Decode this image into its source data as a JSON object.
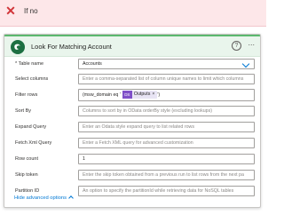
{
  "condition": {
    "title": "If no"
  },
  "card": {
    "title": "Look For Matching Account",
    "help_label": "?",
    "more_label": "···"
  },
  "fields": [
    {
      "label": "* Table name",
      "value": "Accounts",
      "placeholder": ""
    },
    {
      "label": "Select columns",
      "value": "",
      "placeholder": "Enter a comma-separated list of column unique names to limit which columns"
    },
    {
      "label": "Filter rows",
      "value": "(msw_domain eq '",
      "suffix": "')",
      "token": {
        "icon_label": "DS",
        "text": "Outputs",
        "remove": "×"
      }
    },
    {
      "label": "Sort By",
      "value": "",
      "placeholder": "Columns to sort by in OData orderBy style (excluding lookups)"
    },
    {
      "label": "Expand Query",
      "value": "",
      "placeholder": "Enter an Odata style expand query to list related rows"
    },
    {
      "label": "Fetch Xml Query",
      "value": "",
      "placeholder": "Enter a Fetch XML query for advanced customization"
    },
    {
      "label": "Row count",
      "value": "1",
      "placeholder": ""
    },
    {
      "label": "Skip token",
      "value": "",
      "placeholder": "Enter the skip token obtained from a previous run to list rows from the next pa"
    },
    {
      "label": "Partition ID",
      "value": "",
      "placeholder": "An option to specify the partitionId while retrieving data for NoSQL tables"
    }
  ],
  "advanced": {
    "label": "Hide advanced options"
  },
  "colors": {
    "accent": "#0078d4",
    "header_bg": "#e9f5ec",
    "header_border": "#5bb86e",
    "token_icon": "#7f4fc8"
  }
}
